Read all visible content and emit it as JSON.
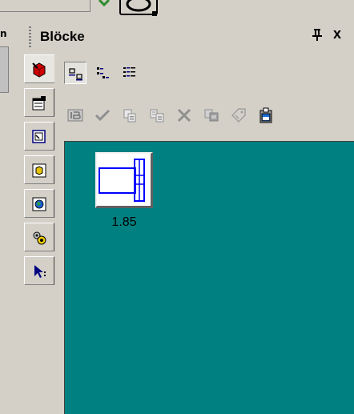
{
  "panel": {
    "title": "Blöcke",
    "close_label": "x"
  },
  "left_edge_label": "n",
  "vertical_tabs": [
    {
      "icon": "red-cube-icon",
      "active": true
    },
    {
      "icon": "properties-icon",
      "active": false
    },
    {
      "icon": "layout-frame-icon",
      "active": false
    },
    {
      "icon": "yellow-box-icon",
      "active": false
    },
    {
      "icon": "globe-icon",
      "active": false
    },
    {
      "icon": "gears-icon",
      "active": false
    },
    {
      "icon": "arrow-pointer-icon",
      "active": false
    }
  ],
  "toolbar_view": [
    {
      "icon": "view-large-icons-icon",
      "pressed": true
    },
    {
      "icon": "view-list-icon",
      "pressed": false
    },
    {
      "icon": "view-details-icon",
      "pressed": false
    }
  ],
  "toolbar_actions": [
    {
      "icon": "insert-block-icon"
    },
    {
      "icon": "checkmark-icon"
    },
    {
      "icon": "copy-icon"
    },
    {
      "icon": "rename-icon"
    },
    {
      "icon": "delete-icon"
    },
    {
      "icon": "duplicate-icon"
    },
    {
      "icon": "tag-icon"
    },
    {
      "icon": "clipboard-paste-icon"
    }
  ],
  "blocks": [
    {
      "label": "1.85"
    }
  ],
  "colors": {
    "content_bg": "#008080",
    "panel_bg": "#d4d0c8",
    "block_line": "#0000ff"
  }
}
